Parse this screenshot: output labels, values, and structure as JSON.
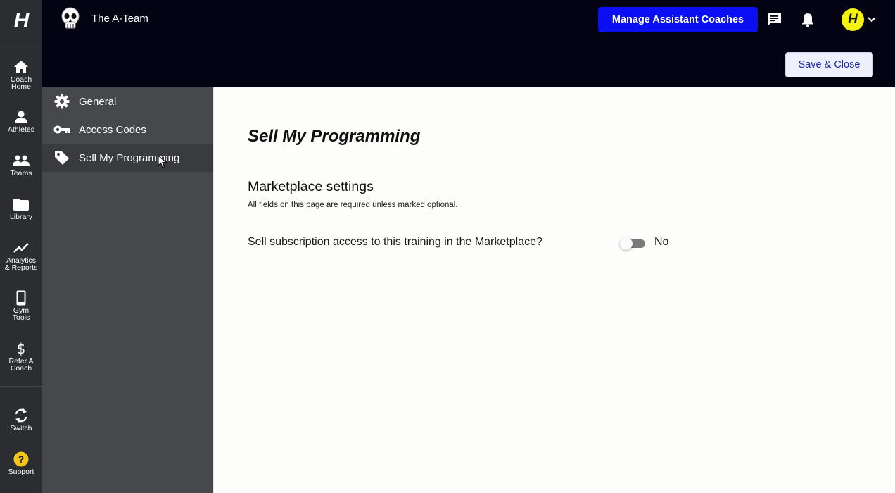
{
  "rail": {
    "logo": "H",
    "items": [
      {
        "label": "Coach\nHome",
        "icon": "home-icon"
      },
      {
        "label": "Athletes",
        "icon": "person-icon"
      },
      {
        "label": "Teams",
        "icon": "group-icon"
      },
      {
        "label": "Library",
        "icon": "folder-icon"
      },
      {
        "label": "Analytics\n& Reports",
        "icon": "trending-icon"
      },
      {
        "label": "Gym\nTools",
        "icon": "phone-icon"
      },
      {
        "label": "Refer A\nCoach",
        "icon": "dollar-icon"
      },
      {
        "label": "Switch",
        "icon": "sync-icon"
      },
      {
        "label": "Support",
        "icon": "help-icon"
      }
    ]
  },
  "header": {
    "team_name": "The A-Team",
    "manage_button": "Manage Assistant Coaches",
    "save_button": "Save & Close",
    "avatar_letter": "H",
    "accent_color": "#0a0ef2",
    "avatar_color": "#f5f20c"
  },
  "subnav": {
    "items": [
      {
        "label": "General",
        "icon": "gear-icon"
      },
      {
        "label": "Access Codes",
        "icon": "key-icon"
      },
      {
        "label": "Sell My Programming",
        "icon": "tag-icon",
        "active": true
      }
    ]
  },
  "main": {
    "page_title": "Sell My Programming",
    "section_title": "Marketplace settings",
    "section_note": "All fields on this page are required unless marked optional.",
    "question": "Sell subscription access to this training in the Marketplace?",
    "toggle_value": "No"
  }
}
